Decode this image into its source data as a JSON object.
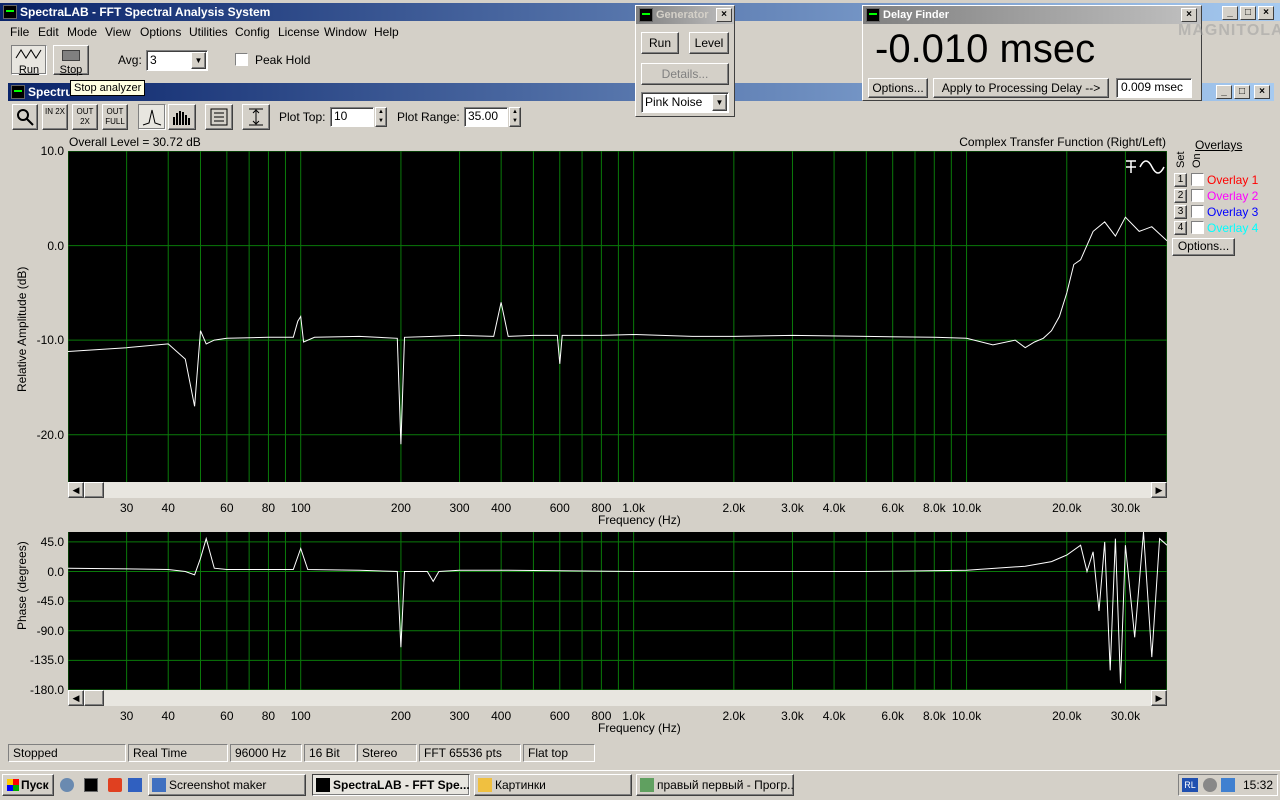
{
  "app": {
    "title": "SpectraLAB - FFT Spectral Analysis System",
    "menu": [
      "File",
      "Edit",
      "Mode",
      "View",
      "Options",
      "Utilities",
      "Config",
      "License",
      "Window",
      "Help"
    ]
  },
  "toolbar": {
    "run_label": "Run",
    "stop_label": "Stop",
    "avg_label": "Avg:",
    "avg_value": "3",
    "peak_hold_label": "Peak Hold",
    "tooltip": "Stop analyzer"
  },
  "spectrum_window": {
    "title": "Spectrum",
    "plot_top_label": "Plot Top:",
    "plot_top_value": "10",
    "plot_range_label": "Plot Range:",
    "plot_range_value": "35.00",
    "zoom_in_label": "IN 2X",
    "zoom_out_label": "OUT 2X",
    "zoom_full_label": "OUT FULL"
  },
  "generator": {
    "title": "Generator",
    "run_label": "Run",
    "level_label": "Level",
    "details_label": "Details...",
    "signal": "Pink Noise"
  },
  "delay_finder": {
    "title": "Delay Finder",
    "value": "-0.010 msec",
    "options_label": "Options...",
    "apply_label": "Apply to Processing Delay -->",
    "delay_value": "0.009 msec",
    "watermark": "MAGNITOLA"
  },
  "overlays": {
    "title": "Overlays",
    "set_label": "Set",
    "on_label": "On",
    "items": [
      {
        "num": "1",
        "label": "Overlay 1",
        "color": "#ff0000"
      },
      {
        "num": "2",
        "label": "Overlay 2",
        "color": "#ff00ff"
      },
      {
        "num": "3",
        "label": "Overlay 3",
        "color": "#0000ff"
      },
      {
        "num": "4",
        "label": "Overlay 4",
        "color": "#00ffff"
      }
    ],
    "options_label": "Options..."
  },
  "chart_data": [
    {
      "type": "line",
      "title": "Complex Transfer Function (Right/Left)",
      "subtitle": "Overall Level = 30.72 dB",
      "xlabel": "Frequency (Hz)",
      "ylabel": "Relative Amplitude (dB)",
      "x_scale": "log",
      "xlim": [
        20,
        40000
      ],
      "ylim": [
        -25,
        10
      ],
      "yticks": [
        "10.0",
        "0.0",
        "-10.0",
        "-20.0"
      ],
      "xticks": [
        {
          "f": 30,
          "label": "30"
        },
        {
          "f": 40,
          "label": "40"
        },
        {
          "f": 60,
          "label": "60"
        },
        {
          "f": 80,
          "label": "80"
        },
        {
          "f": 100,
          "label": "100"
        },
        {
          "f": 200,
          "label": "200"
        },
        {
          "f": 300,
          "label": "300"
        },
        {
          "f": 400,
          "label": "400"
        },
        {
          "f": 600,
          "label": "600"
        },
        {
          "f": 800,
          "label": "800"
        },
        {
          "f": 1000,
          "label": "1.0k"
        },
        {
          "f": 2000,
          "label": "2.0k"
        },
        {
          "f": 3000,
          "label": "3.0k"
        },
        {
          "f": 4000,
          "label": "4.0k"
        },
        {
          "f": 6000,
          "label": "6.0k"
        },
        {
          "f": 8000,
          "label": "8.0k"
        },
        {
          "f": 10000,
          "label": "10.0k"
        },
        {
          "f": 20000,
          "label": "20.0k"
        },
        {
          "f": 30000,
          "label": "30.0k"
        }
      ],
      "grid": true,
      "series": [
        {
          "color": "#ffffff",
          "x": [
            20,
            30,
            40,
            45,
            48,
            50,
            52,
            55,
            60,
            80,
            95,
            98,
            100,
            102,
            110,
            150,
            195,
            200,
            205,
            250,
            300,
            380,
            400,
            420,
            500,
            590,
            600,
            610,
            700,
            800,
            1000,
            1500,
            2000,
            3000,
            5000,
            8000,
            10000,
            12000,
            14000,
            15000,
            16000,
            17000,
            18000,
            19000,
            20000,
            21000,
            22000,
            24000,
            26000,
            28000,
            30000,
            33000,
            36000,
            40000
          ],
          "y": [
            -11.2,
            -10.8,
            -10.4,
            -12.0,
            -17.0,
            -9.0,
            -10.4,
            -10.0,
            -9.8,
            -9.7,
            -9.7,
            -8.0,
            -7.5,
            -10.2,
            -9.7,
            -9.6,
            -9.8,
            -21.0,
            -9.7,
            -9.6,
            -9.5,
            -9.6,
            -6.0,
            -9.6,
            -9.5,
            -9.5,
            -12.5,
            -9.5,
            -9.5,
            -9.5,
            -9.4,
            -9.6,
            -9.6,
            -9.5,
            -9.6,
            -9.7,
            -9.8,
            -10.5,
            -10.0,
            -10.8,
            -10.2,
            -9.8,
            -9.0,
            -7.5,
            -5.0,
            -2.0,
            -1.5,
            1.5,
            2.5,
            1.0,
            3.0,
            1.5,
            2.0,
            0.5
          ]
        }
      ]
    },
    {
      "type": "line",
      "xlabel": "Frequency (Hz)",
      "ylabel": "Phase (degrees)",
      "x_scale": "log",
      "xlim": [
        20,
        40000
      ],
      "ylim": [
        -180,
        60
      ],
      "yticks": [
        "45.0",
        "0.0",
        "-45.0",
        "-90.0",
        "-135.0",
        "-180.0"
      ],
      "xticks": [
        {
          "f": 30,
          "label": "30"
        },
        {
          "f": 40,
          "label": "40"
        },
        {
          "f": 60,
          "label": "60"
        },
        {
          "f": 80,
          "label": "80"
        },
        {
          "f": 100,
          "label": "100"
        },
        {
          "f": 200,
          "label": "200"
        },
        {
          "f": 300,
          "label": "300"
        },
        {
          "f": 400,
          "label": "400"
        },
        {
          "f": 600,
          "label": "600"
        },
        {
          "f": 800,
          "label": "800"
        },
        {
          "f": 1000,
          "label": "1.0k"
        },
        {
          "f": 2000,
          "label": "2.0k"
        },
        {
          "f": 3000,
          "label": "3.0k"
        },
        {
          "f": 4000,
          "label": "4.0k"
        },
        {
          "f": 6000,
          "label": "6.0k"
        },
        {
          "f": 8000,
          "label": "8.0k"
        },
        {
          "f": 10000,
          "label": "10.0k"
        },
        {
          "f": 20000,
          "label": "20.0k"
        },
        {
          "f": 30000,
          "label": "30.0k"
        }
      ],
      "grid": true,
      "series": [
        {
          "color": "#ffffff",
          "x": [
            20,
            30,
            40,
            45,
            48,
            50,
            52,
            55,
            60,
            80,
            95,
            100,
            105,
            150,
            195,
            200,
            205,
            240,
            250,
            260,
            300,
            400,
            600,
            1000,
            2000,
            5000,
            10000,
            15000,
            18000,
            20000,
            22000,
            23000,
            24000,
            25000,
            26000,
            27000,
            28000,
            29000,
            30000,
            32000,
            34000,
            36000,
            38000,
            40000
          ],
          "y": [
            5,
            4,
            3,
            0,
            -5,
            20,
            50,
            5,
            3,
            3,
            3,
            35,
            3,
            2,
            0,
            -115,
            0,
            0,
            -15,
            0,
            2,
            2,
            1,
            0,
            0,
            0,
            2,
            8,
            15,
            25,
            40,
            0,
            30,
            -60,
            45,
            -150,
            50,
            -170,
            40,
            -100,
            60,
            -130,
            50,
            40
          ]
        }
      ]
    }
  ],
  "status_bar": [
    "Stopped",
    "Real Time",
    "96000 Hz",
    "16 Bit",
    "Stereo",
    "FFT 65536 pts",
    "Flat top"
  ],
  "taskbar": {
    "start_label": "Пуск",
    "tasks": [
      "Screenshot maker",
      "SpectraLAB - FFT Spe...",
      "Картинки",
      "правый первый - Прогр..."
    ],
    "language": "RL",
    "clock": "15:32"
  }
}
